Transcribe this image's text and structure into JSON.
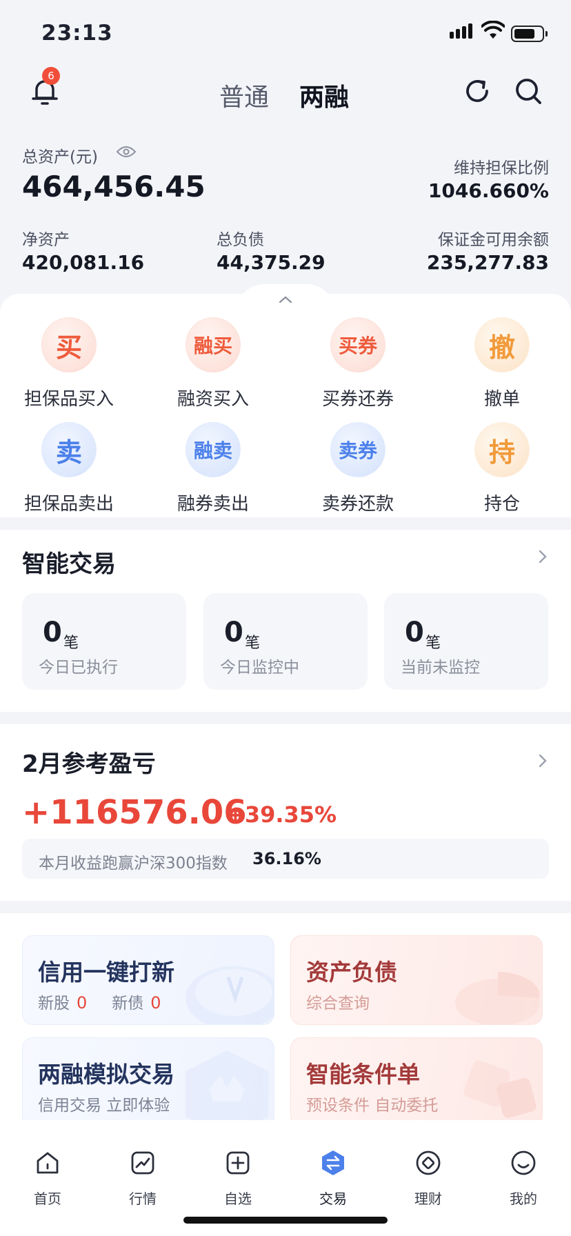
{
  "status_bar": {
    "time": "23:13"
  },
  "header": {
    "notification_count": "6",
    "tabs": [
      {
        "label": "普通",
        "active": false
      },
      {
        "label": "两融",
        "active": true
      }
    ]
  },
  "assets": {
    "total_label": "总资产(元)",
    "total_value": "464,456.45",
    "ratio_label": "维持担保比例",
    "ratio_value": "1046.660%",
    "net_label": "净资产",
    "net_value": "420,081.16",
    "debt_label": "总负债",
    "debt_value": "44,375.29",
    "margin_label": "保证金可用余额",
    "margin_value": "235,277.83"
  },
  "actions": [
    {
      "glyph": "买",
      "label": "担保品买入",
      "color": "red"
    },
    {
      "glyph": "融买",
      "label": "融资买入",
      "color": "red"
    },
    {
      "glyph": "买券",
      "label": "买券还券",
      "color": "red"
    },
    {
      "glyph": "撤",
      "label": "撤单",
      "color": "orange"
    },
    {
      "glyph": "卖",
      "label": "担保品卖出",
      "color": "blue"
    },
    {
      "glyph": "融卖",
      "label": "融券卖出",
      "color": "blue"
    },
    {
      "glyph": "卖券",
      "label": "卖券还款",
      "color": "blue"
    },
    {
      "glyph": "持",
      "label": "持仓",
      "color": "orange"
    }
  ],
  "smart_trade": {
    "title": "智能交易",
    "unit": "笔",
    "stats": [
      {
        "value": "0",
        "label": "今日已执行"
      },
      {
        "value": "0",
        "label": "今日监控中"
      },
      {
        "value": "0",
        "label": "当前未监控"
      }
    ]
  },
  "pnl": {
    "title": "2月参考盈亏",
    "value": "+116576.06",
    "percent": "+39.35%",
    "benchmark_label": "本月收益跑赢沪深300指数",
    "benchmark_value": "36.16%"
  },
  "features": {
    "ipo": {
      "title": "信用一键打新",
      "stock_label": "新股",
      "stock_count": "0",
      "bond_label": "新债",
      "bond_count": "0"
    },
    "balance": {
      "title": "资产负债",
      "sub": "综合查询"
    },
    "sim": {
      "title": "两融模拟交易",
      "sub": "信用交易 立即体验"
    },
    "condition": {
      "title": "智能条件单",
      "sub": "预设条件 自动委托"
    }
  },
  "tabbar": [
    {
      "label": "首页",
      "icon": "home-icon"
    },
    {
      "label": "行情",
      "icon": "market-icon"
    },
    {
      "label": "自选",
      "icon": "watchlist-icon"
    },
    {
      "label": "交易",
      "icon": "trade-icon",
      "active": true
    },
    {
      "label": "理财",
      "icon": "wealth-icon"
    },
    {
      "label": "我的",
      "icon": "profile-icon"
    }
  ],
  "colors": {
    "red": "#e8473a",
    "blue_accent": "#4c80ea",
    "orange": "#f19a3a"
  }
}
